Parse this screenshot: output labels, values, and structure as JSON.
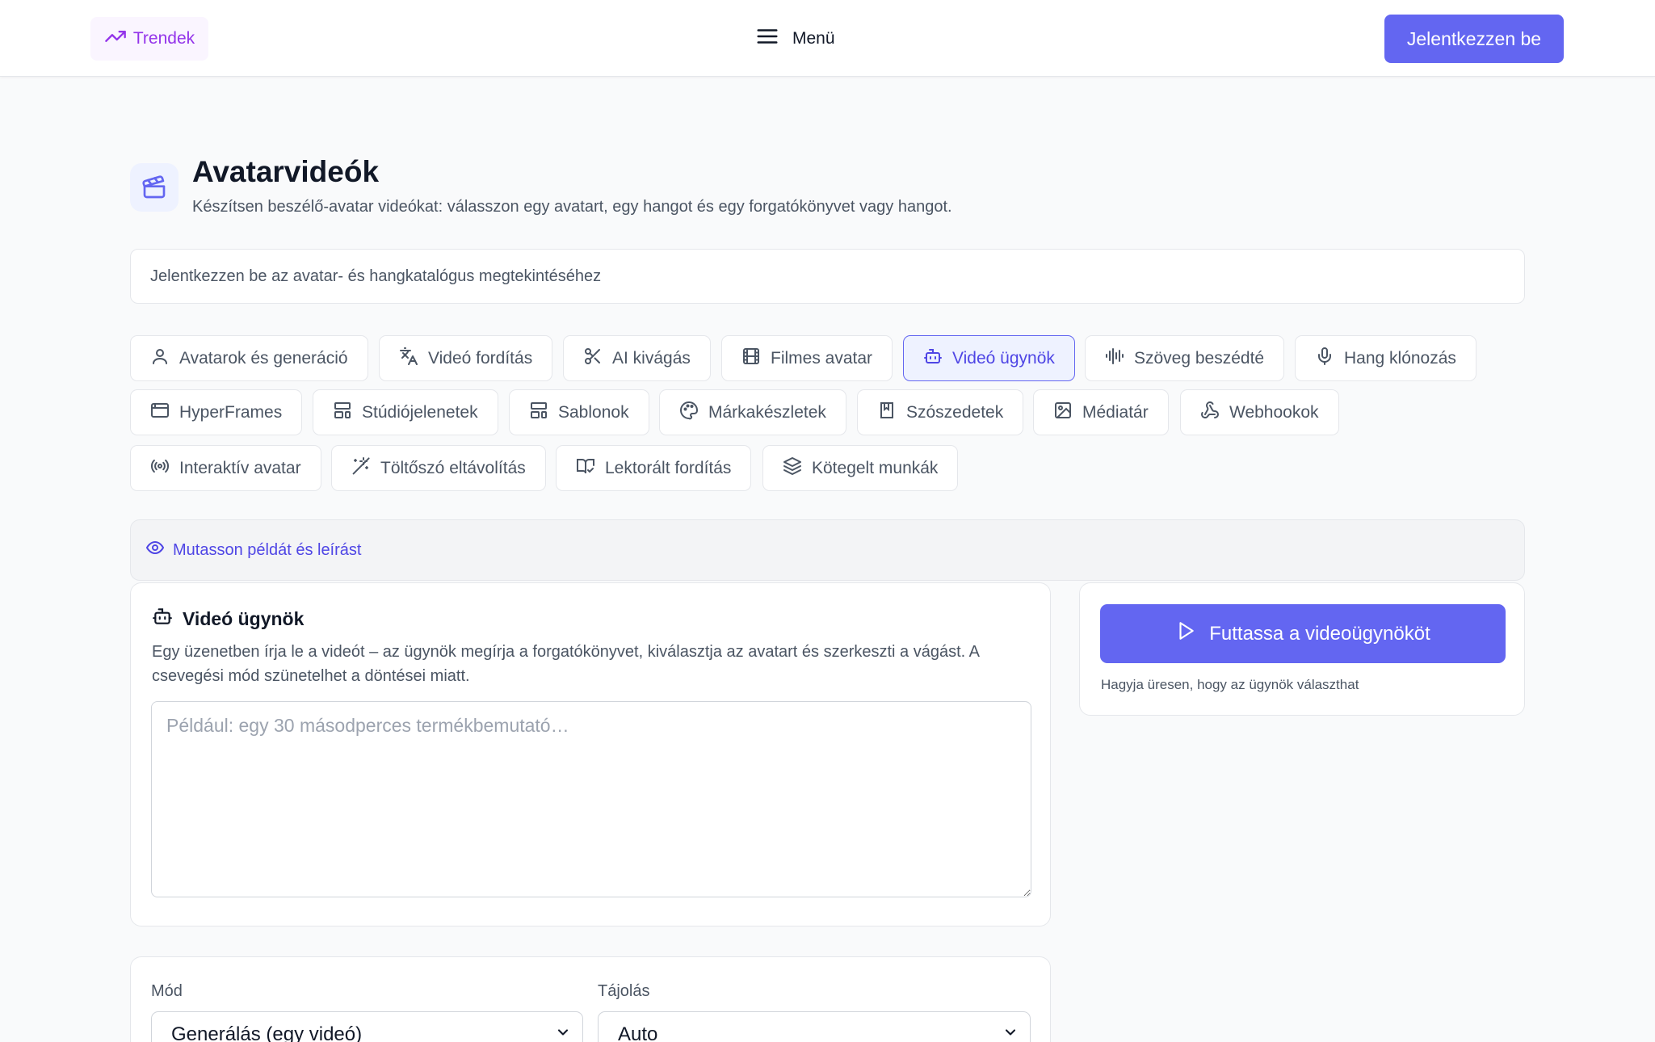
{
  "header": {
    "trends_label": "Trendek",
    "menu_label": "Menü",
    "login_label": "Jelentkezzen be"
  },
  "page": {
    "title": "Avatarvideók",
    "subtitle": "Készítsen beszélő-avatar videókat: válasszon egy avatart, egy hangot és egy forgatókönyvet vagy hangot.",
    "notice": "Jelentkezzen be az avatar- és hangkatalógus megtekintéséhez"
  },
  "tabs": [
    {
      "label": "Avatarok és generáció",
      "icon": "user-icon"
    },
    {
      "label": "Videó fordítás",
      "icon": "translate-icon"
    },
    {
      "label": "AI kivágás",
      "icon": "scissors-icon"
    },
    {
      "label": "Filmes avatar",
      "icon": "film-icon"
    },
    {
      "label": "Videó ügynök",
      "icon": "bot-icon",
      "active": true
    },
    {
      "label": "Szöveg beszédté",
      "icon": "audio-waveform-icon"
    },
    {
      "label": "Hang klónozás",
      "icon": "mic-icon"
    },
    {
      "label": "HyperFrames",
      "icon": "browser-window-icon"
    },
    {
      "label": "Stúdiójelenetek",
      "icon": "layout-icon"
    },
    {
      "label": "Sablonok",
      "icon": "layout-template-icon"
    },
    {
      "label": "Márkakészletek",
      "icon": "palette-icon"
    },
    {
      "label": "Szószedetek",
      "icon": "book-icon"
    },
    {
      "label": "Médiatár",
      "icon": "image-icon"
    },
    {
      "label": "Webhookok",
      "icon": "webhook-icon"
    },
    {
      "label": "Interaktív avatar",
      "icon": "broadcast-icon"
    },
    {
      "label": "Töltőszó eltávolítás",
      "icon": "magic-wand-icon"
    },
    {
      "label": "Lektorált fordítás",
      "icon": "book-check-icon"
    },
    {
      "label": "Kötegelt munkák",
      "icon": "layers-icon"
    }
  ],
  "example_toggle": "Mutasson példát és leírást",
  "agent": {
    "title": "Videó ügynök",
    "description": "Egy üzenetben írja le a videót – az ügynök megírja a forgatókönyvet, kiválasztja az avatart és szerkeszti a vágást. A csevegési mód szünetelhet a döntései miatt.",
    "placeholder": "Például: egy 30 másodperces termékbemutató…"
  },
  "run": {
    "button_label": "Futtassa a videoügynököt",
    "hint": "Hagyja üresen, hogy az ügynök választhat"
  },
  "settings": {
    "mode_label": "Mód",
    "mode_value": "Generálás (egy videó)",
    "orientation_label": "Tájolás",
    "orientation_value": "Auto"
  },
  "colors": {
    "accent": "#6366f1",
    "trend_purple": "#9333ea"
  }
}
